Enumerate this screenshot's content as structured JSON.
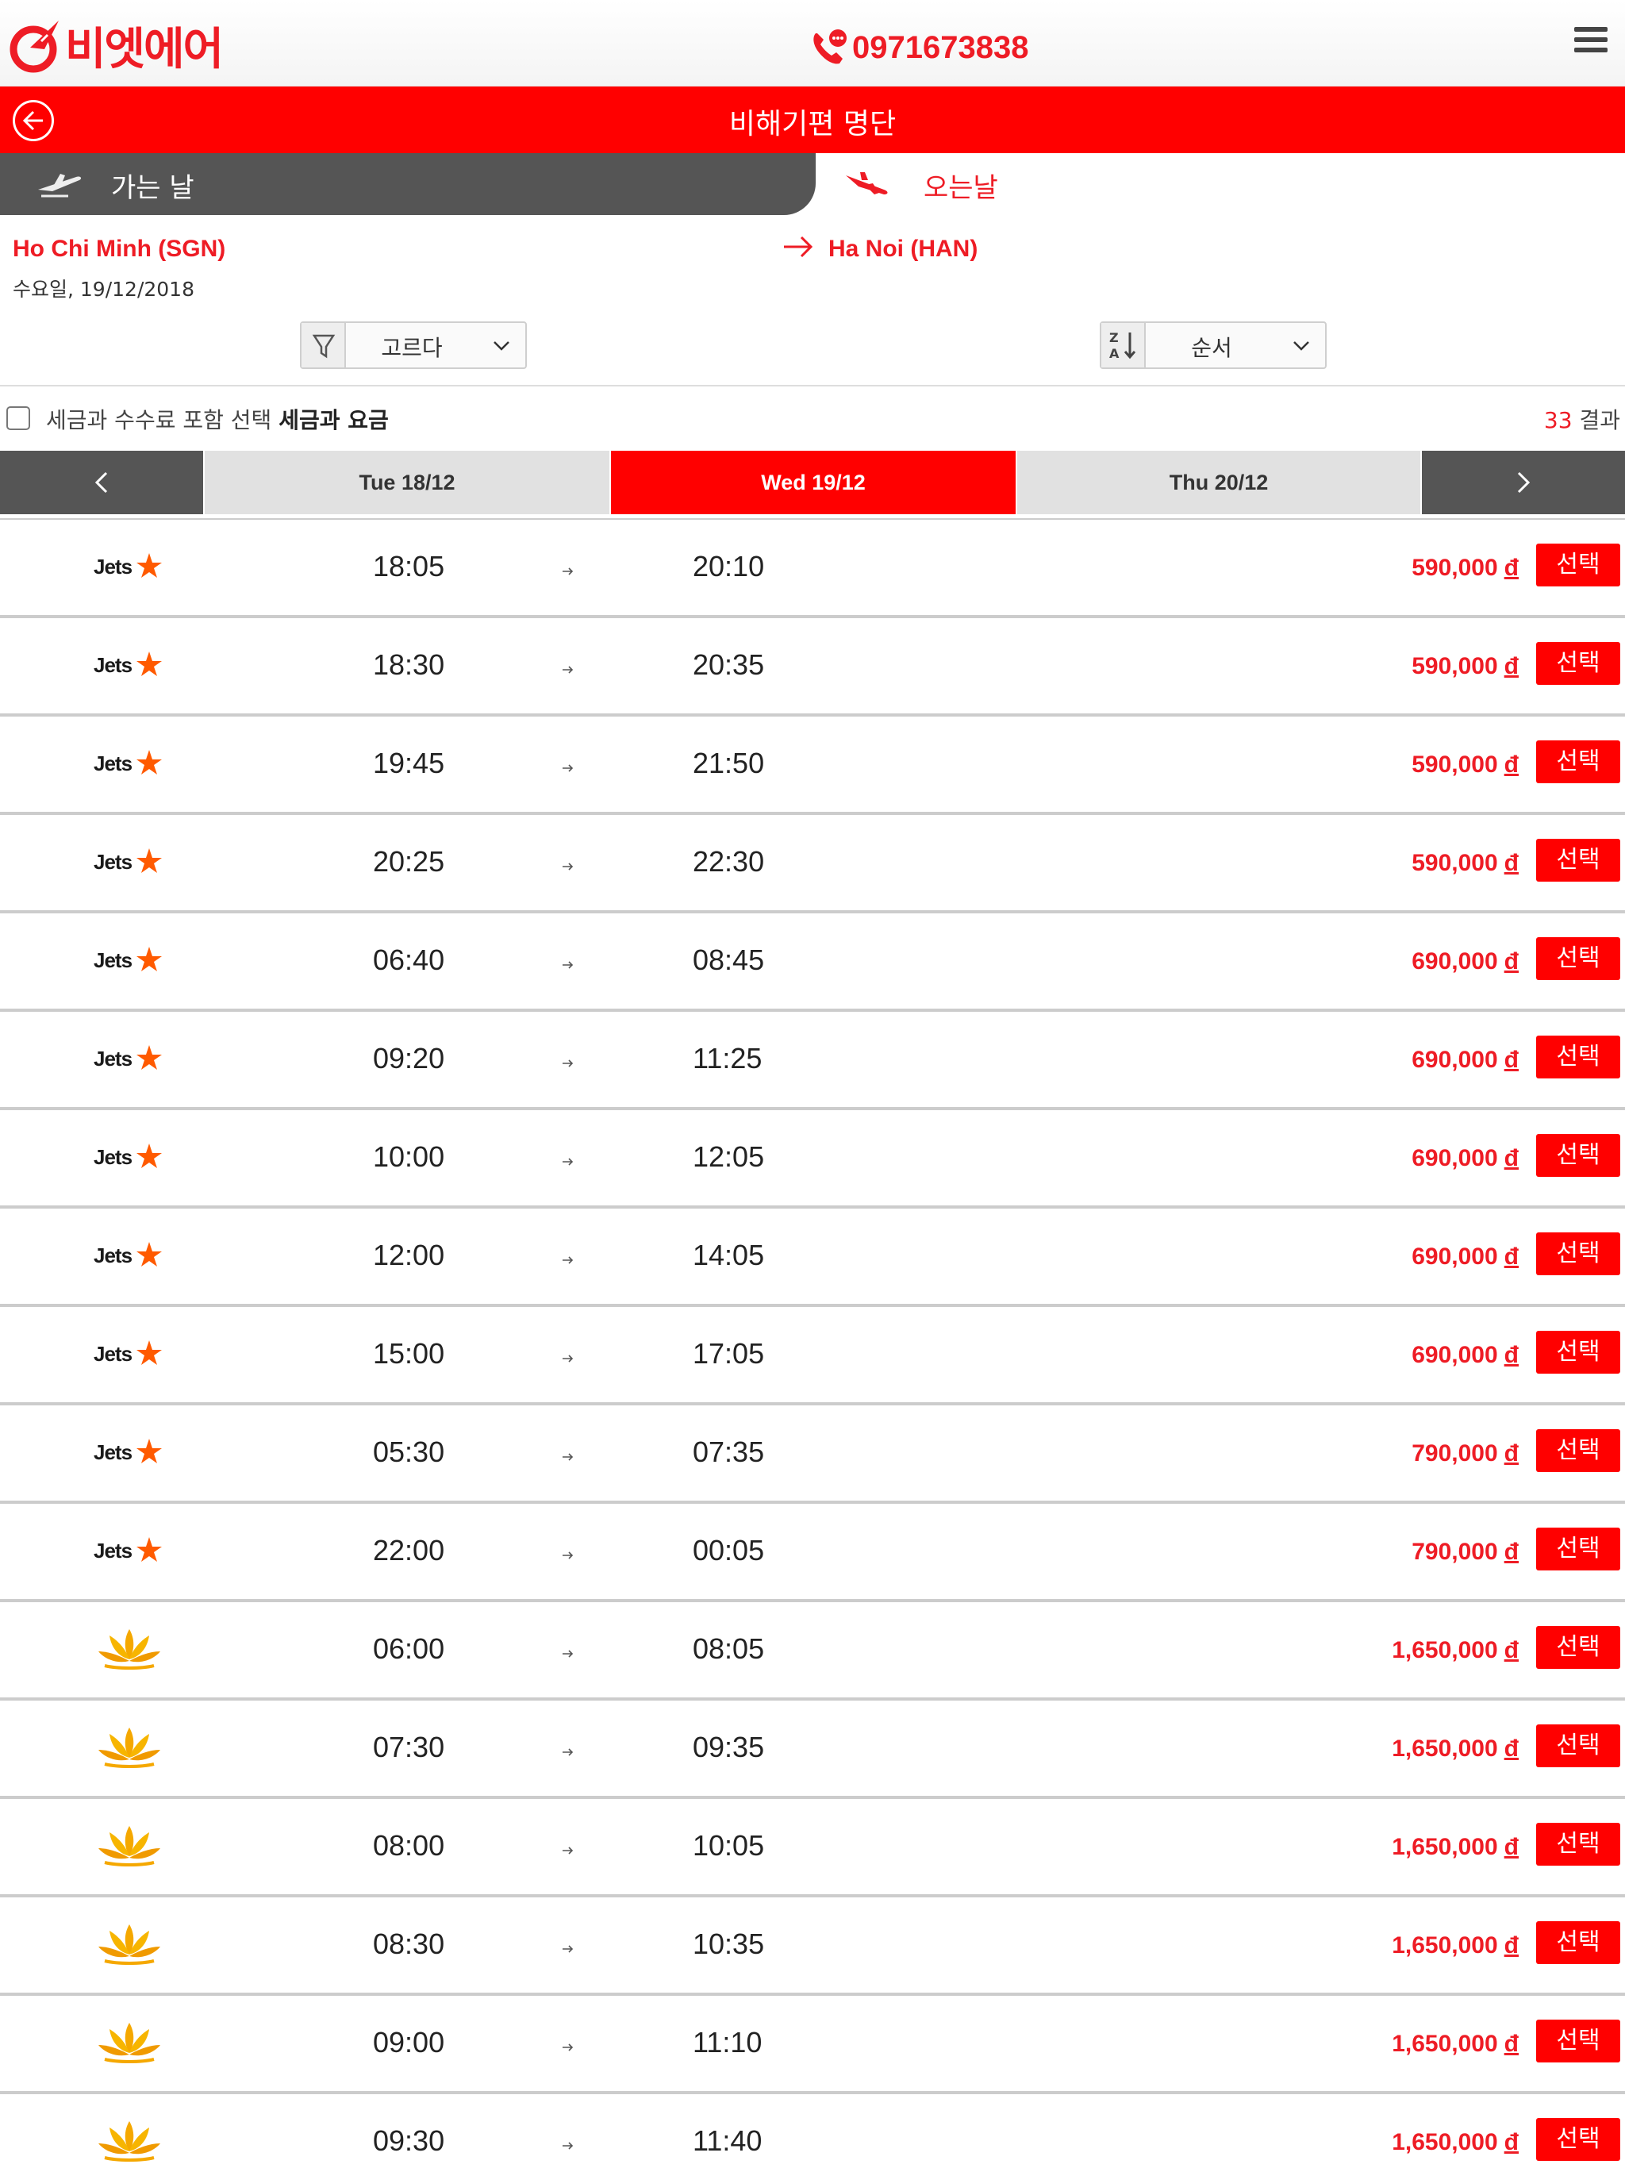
{
  "header": {
    "logo_text": "비엣에어",
    "phone": "0971673838"
  },
  "titlebar": {
    "title": "비해기편 명단"
  },
  "tabs": {
    "outbound": "가는 날",
    "return": "오는날"
  },
  "route": {
    "origin": "Ho Chi Minh (SGN)",
    "date": "수요일, 19/12/2018",
    "destination": "Ha Noi (HAN)"
  },
  "filter": {
    "label": "고르다"
  },
  "sort": {
    "label": "순서"
  },
  "tax": {
    "label": "세금과 수수료 포함 선택",
    "bold": "세금과 요금",
    "checked": false
  },
  "results": {
    "count": "33",
    "label": "결과"
  },
  "date_nav": {
    "days": [
      {
        "label": "Tue 18/12",
        "active": false
      },
      {
        "label": "Wed 19/12",
        "active": true
      },
      {
        "label": "Thu 20/12",
        "active": false
      }
    ]
  },
  "select_label": "선택",
  "currency": "đ",
  "airlines": {
    "jetstar": {
      "logo_icon": "jetstar-logo-icon",
      "brand_color": "#ff5a00",
      "text": "Jets"
    },
    "vietnam": {
      "logo_icon": "lotus-logo-icon",
      "brand_color": "#f5a800"
    }
  },
  "colors": {
    "accent": "#ff0000",
    "dark_tab": "#555555",
    "price": "#ee1c25"
  },
  "flights": [
    {
      "airline": "jetstar",
      "dep": "18:05",
      "arr": "20:10",
      "price": "590,000"
    },
    {
      "airline": "jetstar",
      "dep": "18:30",
      "arr": "20:35",
      "price": "590,000"
    },
    {
      "airline": "jetstar",
      "dep": "19:45",
      "arr": "21:50",
      "price": "590,000"
    },
    {
      "airline": "jetstar",
      "dep": "20:25",
      "arr": "22:30",
      "price": "590,000"
    },
    {
      "airline": "jetstar",
      "dep": "06:40",
      "arr": "08:45",
      "price": "690,000"
    },
    {
      "airline": "jetstar",
      "dep": "09:20",
      "arr": "11:25",
      "price": "690,000"
    },
    {
      "airline": "jetstar",
      "dep": "10:00",
      "arr": "12:05",
      "price": "690,000"
    },
    {
      "airline": "jetstar",
      "dep": "12:00",
      "arr": "14:05",
      "price": "690,000"
    },
    {
      "airline": "jetstar",
      "dep": "15:00",
      "arr": "17:05",
      "price": "690,000"
    },
    {
      "airline": "jetstar",
      "dep": "05:30",
      "arr": "07:35",
      "price": "790,000"
    },
    {
      "airline": "jetstar",
      "dep": "22:00",
      "arr": "00:05",
      "price": "790,000"
    },
    {
      "airline": "vietnam",
      "dep": "06:00",
      "arr": "08:05",
      "price": "1,650,000"
    },
    {
      "airline": "vietnam",
      "dep": "07:30",
      "arr": "09:35",
      "price": "1,650,000"
    },
    {
      "airline": "vietnam",
      "dep": "08:00",
      "arr": "10:05",
      "price": "1,650,000"
    },
    {
      "airline": "vietnam",
      "dep": "08:30",
      "arr": "10:35",
      "price": "1,650,000"
    },
    {
      "airline": "vietnam",
      "dep": "09:00",
      "arr": "11:10",
      "price": "1,650,000"
    },
    {
      "airline": "vietnam",
      "dep": "09:30",
      "arr": "11:40",
      "price": "1,650,000"
    }
  ]
}
